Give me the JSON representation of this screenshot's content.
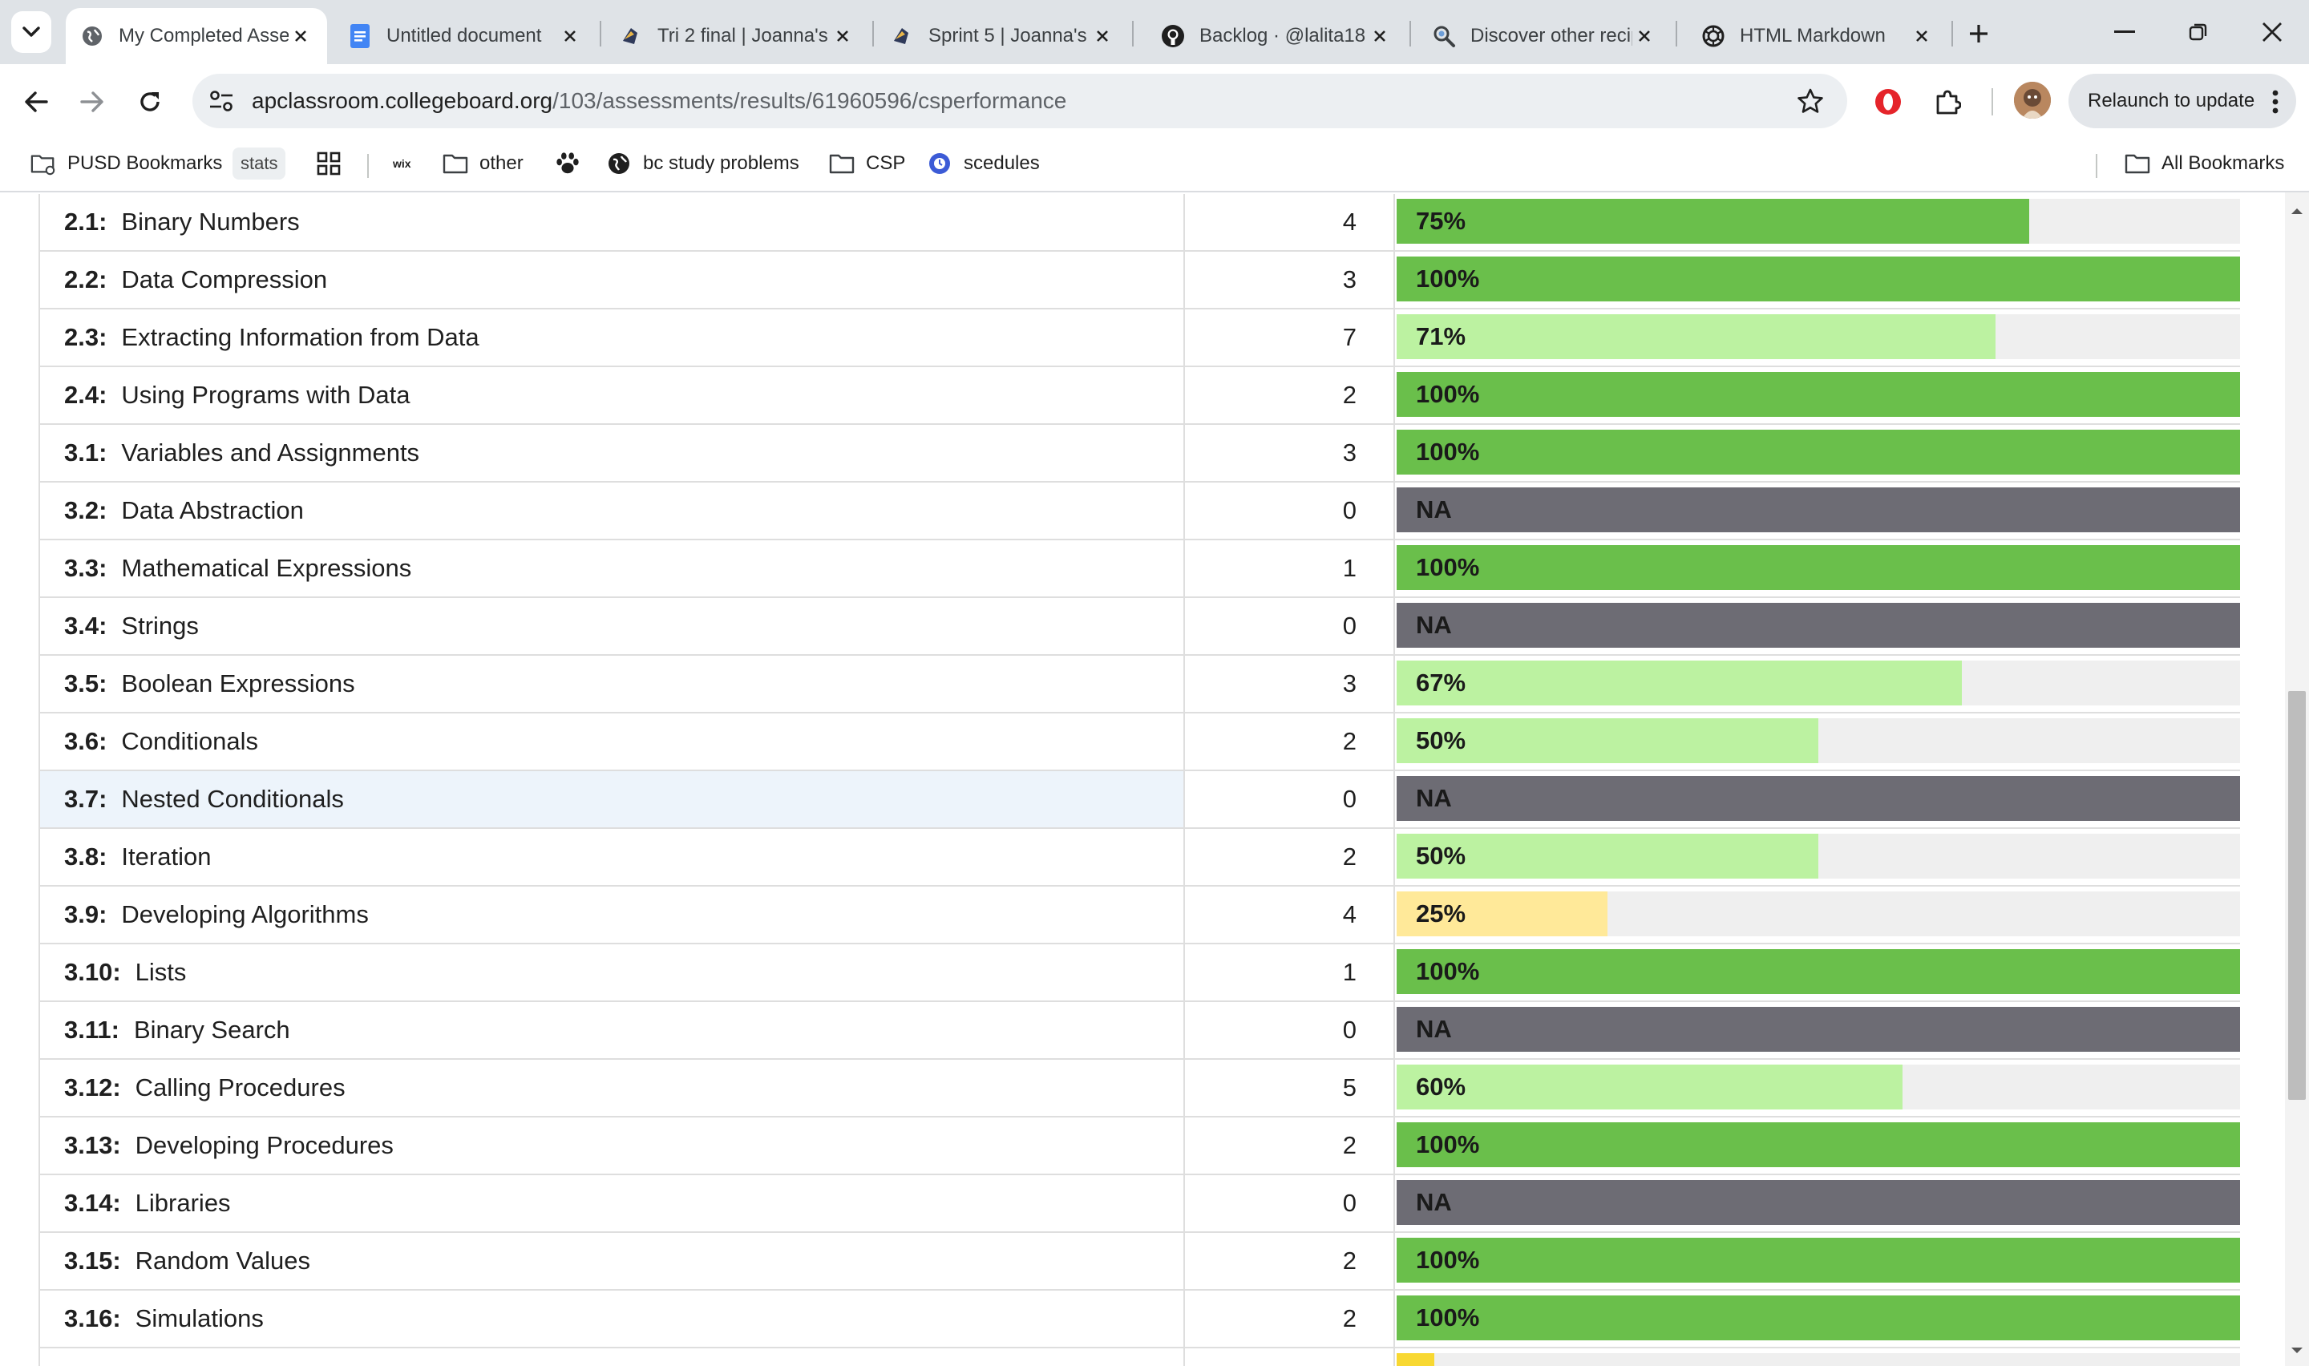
{
  "browser": {
    "tabs": [
      {
        "title": "My Completed Assessments",
        "icon": "globe-icon",
        "active": true
      },
      {
        "title": "Untitled document",
        "icon": "docs-icon",
        "active": false
      },
      {
        "title": "Tri 2 final | Joanna's",
        "icon": "blog-icon",
        "active": false
      },
      {
        "title": "Sprint 5 | Joanna's",
        "icon": "blog-icon",
        "active": false
      },
      {
        "title": "Backlog · @lalita18",
        "icon": "github-icon",
        "active": false
      },
      {
        "title": "Discover other recipes",
        "icon": "recipe-icon",
        "active": false
      },
      {
        "title": "HTML Markdown",
        "icon": "openai-icon",
        "active": false
      }
    ],
    "url_host": "apclassroom.collegeboard.org",
    "url_path": "/103/assessments/results/61960596/csperformance",
    "relaunch_label": "Relaunch to update"
  },
  "bookmarks": {
    "items": [
      {
        "label": "PUSD Bookmarks",
        "icon": "folder-gear-icon"
      },
      {
        "label": "stats",
        "icon": ""
      },
      {
        "label": "",
        "icon": "apps-grid-icon"
      },
      {
        "label": "wix",
        "icon": ""
      },
      {
        "label": "other",
        "icon": "folder-icon"
      },
      {
        "label": "",
        "icon": "paw-icon"
      },
      {
        "label": "bc study problems",
        "icon": "globe-icon"
      },
      {
        "label": "CSP",
        "icon": "folder-icon"
      },
      {
        "label": "scedules",
        "icon": "schedule-icon"
      }
    ],
    "all_label": "All Bookmarks"
  },
  "colors": {
    "dark_green": "#6abf4b",
    "light_green": "#bcf2a1",
    "yellow": "#ffe999",
    "na_gray": "#6d6c74",
    "track": "#efefef",
    "partial_yellow": "#f8d832"
  },
  "performance": {
    "rows": [
      {
        "code": "2.1:",
        "name": "Binary Numbers",
        "count": "4",
        "label": "75%",
        "fraction": 0.75,
        "color": "dark_green"
      },
      {
        "code": "2.2:",
        "name": "Data Compression",
        "count": "3",
        "label": "100%",
        "fraction": 1.0,
        "color": "dark_green"
      },
      {
        "code": "2.3:",
        "name": "Extracting Information from Data",
        "count": "7",
        "label": "71%",
        "fraction": 0.71,
        "color": "light_green"
      },
      {
        "code": "2.4:",
        "name": "Using Programs with Data",
        "count": "2",
        "label": "100%",
        "fraction": 1.0,
        "color": "dark_green"
      },
      {
        "code": "3.1:",
        "name": "Variables and Assignments",
        "count": "3",
        "label": "100%",
        "fraction": 1.0,
        "color": "dark_green"
      },
      {
        "code": "3.2:",
        "name": "Data Abstraction",
        "count": "0",
        "label": "NA",
        "fraction": 1.0,
        "color": "na_gray"
      },
      {
        "code": "3.3:",
        "name": "Mathematical Expressions",
        "count": "1",
        "label": "100%",
        "fraction": 1.0,
        "color": "dark_green"
      },
      {
        "code": "3.4:",
        "name": "Strings",
        "count": "0",
        "label": "NA",
        "fraction": 1.0,
        "color": "na_gray"
      },
      {
        "code": "3.5:",
        "name": "Boolean Expressions",
        "count": "3",
        "label": "67%",
        "fraction": 0.67,
        "color": "light_green"
      },
      {
        "code": "3.6:",
        "name": "Conditionals",
        "count": "2",
        "label": "50%",
        "fraction": 0.5,
        "color": "light_green"
      },
      {
        "code": "3.7:",
        "name": "Nested Conditionals",
        "count": "0",
        "label": "NA",
        "fraction": 1.0,
        "color": "na_gray",
        "highlight": true
      },
      {
        "code": "3.8:",
        "name": "Iteration",
        "count": "2",
        "label": "50%",
        "fraction": 0.5,
        "color": "light_green"
      },
      {
        "code": "3.9:",
        "name": "Developing Algorithms",
        "count": "4",
        "label": "25%",
        "fraction": 0.25,
        "color": "yellow"
      },
      {
        "code": "3.10:",
        "name": "Lists",
        "count": "1",
        "label": "100%",
        "fraction": 1.0,
        "color": "dark_green"
      },
      {
        "code": "3.11:",
        "name": "Binary Search",
        "count": "0",
        "label": "NA",
        "fraction": 1.0,
        "color": "na_gray"
      },
      {
        "code": "3.12:",
        "name": "Calling Procedures",
        "count": "5",
        "label": "60%",
        "fraction": 0.6,
        "color": "light_green"
      },
      {
        "code": "3.13:",
        "name": "Developing Procedures",
        "count": "2",
        "label": "100%",
        "fraction": 1.0,
        "color": "dark_green"
      },
      {
        "code": "3.14:",
        "name": "Libraries",
        "count": "0",
        "label": "NA",
        "fraction": 1.0,
        "color": "na_gray"
      },
      {
        "code": "3.15:",
        "name": "Random Values",
        "count": "2",
        "label": "100%",
        "fraction": 1.0,
        "color": "dark_green"
      },
      {
        "code": "3.16:",
        "name": "Simulations",
        "count": "2",
        "label": "100%",
        "fraction": 1.0,
        "color": "dark_green"
      }
    ],
    "partial_row": {
      "fraction": 0.045,
      "color": "partial_yellow"
    }
  }
}
